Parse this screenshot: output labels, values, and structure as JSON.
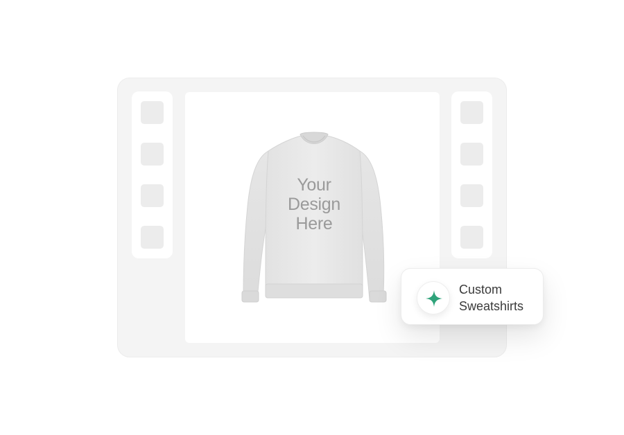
{
  "preview": {
    "design_text": [
      "Your",
      "Design",
      "Here"
    ]
  },
  "badge": {
    "icon": "sparkle-icon",
    "label_line1": "Custom",
    "label_line2": "Sweatshirts"
  },
  "colors": {
    "accent": "#2fa37a",
    "frame_bg": "#f4f4f4",
    "thumb": "#ececec"
  }
}
